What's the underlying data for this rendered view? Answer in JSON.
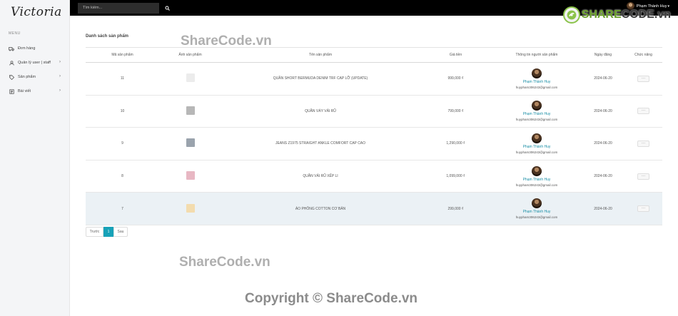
{
  "sidebar": {
    "brand": "Victoria",
    "menu_title": "MENU",
    "items": [
      {
        "label": "Đơn hàng",
        "icon": "truck-icon",
        "has_submenu": false
      },
      {
        "label": "Quản lý user | staff",
        "icon": "user-icon",
        "has_submenu": true
      },
      {
        "label": "Sản phẩm",
        "icon": "tag-icon",
        "has_submenu": true
      },
      {
        "label": "Bài viết",
        "icon": "document-icon",
        "has_submenu": true
      }
    ]
  },
  "topbar": {
    "search_placeholder": "Tìm kiếm...",
    "search_icon": "search-icon",
    "user_name": "Phạm Thành Huy"
  },
  "watermark": {
    "logo_share": "SHARE",
    "logo_code": "CODE.vn",
    "text_top": "ShareCode.vn",
    "text_mid": "ShareCode.vn",
    "text_bottom": "Copyright © ShareCode.vn"
  },
  "main": {
    "title": "Danh sách sản phẩm",
    "columns": [
      "Mã sản phẩm",
      "Ảnh sản phẩm",
      "Tên sản phẩm",
      "Giá tiền",
      "Thông tin người sản phẩm",
      "Ngày đăng",
      "Chức năng"
    ],
    "rows": [
      {
        "id": "11",
        "thumb_color": "#ececec",
        "name": "QUẦN SHORT BERMUDA DENIM TRF CẠP LỠ (UPDATE)",
        "price": "999,000 ₫",
        "owner_name": "Phạm Thành Huy",
        "owner_email": "huypham306243@gmail.com",
        "date": "2024-06-20",
        "action": "···",
        "highlight": false
      },
      {
        "id": "10",
        "thumb_color": "#b7b7b7",
        "name": "QUẦN VÁY VẢI RŨ",
        "price": "799,000 ₫",
        "owner_name": "Phạm Thành Huy",
        "owner_email": "huypham306243@gmail.com",
        "date": "2024-06-20",
        "action": "···",
        "highlight": false
      },
      {
        "id": "9",
        "thumb_color": "#9aa3ad",
        "name": "JEANS Z1975 STRAIGHT ANKLE COMFORT CẠP CAO",
        "price": "1,290,000 ₫",
        "owner_name": "Phạm Thành Huy",
        "owner_email": "huypham306243@gmail.com",
        "date": "2024-06-20",
        "action": "···",
        "highlight": false
      },
      {
        "id": "8",
        "thumb_color": "#e8b7c3",
        "name": "QUẦN VẢI RŨ XẾP LI",
        "price": "1,099,000 ₫",
        "owner_name": "Phạm Thành Huy",
        "owner_email": "huypham306243@gmail.com",
        "date": "2024-06-20",
        "action": "···",
        "highlight": false
      },
      {
        "id": "7",
        "thumb_color": "#f3dcae",
        "name": "ÁO PHÔNG COTTON CƠ BẢN",
        "price": "299,000 ₫",
        "owner_name": "Phạm Thành Huy",
        "owner_email": "huypham306243@gmail.com",
        "date": "2024-06-20",
        "action": "···",
        "highlight": true
      }
    ],
    "pagination": {
      "prev": "Trước",
      "current": "1",
      "next": "Sau"
    }
  }
}
